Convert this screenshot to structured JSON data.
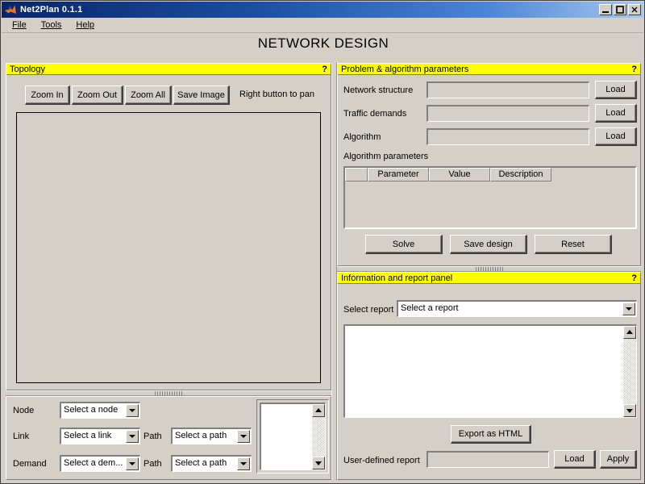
{
  "window": {
    "title": "Net2Plan 0.1.1",
    "icon": "matlab-icon",
    "controls": {
      "minimize": "_",
      "maximize": "□",
      "close": "✕"
    }
  },
  "menubar": {
    "items": [
      {
        "label": "File",
        "mnemonic": "F"
      },
      {
        "label": "Tools",
        "mnemonic": "T"
      },
      {
        "label": "Help",
        "mnemonic": "H"
      }
    ]
  },
  "heading": "NETWORK DESIGN",
  "topology_panel": {
    "title": "Topology",
    "help": "?",
    "buttons": [
      "Zoom In",
      "Zoom Out",
      "Zoom All",
      "Save Image"
    ],
    "hint": "Right button to pan",
    "canvas_content": ""
  },
  "selectors": {
    "node": {
      "label": "Node",
      "value": "Select a node"
    },
    "link": {
      "label": "Link",
      "value": "Select a link"
    },
    "link_path": {
      "label": "Path",
      "value": "Select a path"
    },
    "demand": {
      "label": "Demand",
      "value": "Select a dem..."
    },
    "demand_path": {
      "label": "Path",
      "value": "Select a path"
    },
    "detail_text": ""
  },
  "problem_panel": {
    "title": "Problem & algorithm parameters",
    "help": "?",
    "fields": [
      {
        "label": "Network structure",
        "value": "",
        "button": "Load"
      },
      {
        "label": "Traffic demands",
        "value": "",
        "button": "Load"
      },
      {
        "label": "Algorithm",
        "value": "",
        "button": "Load"
      }
    ],
    "table_label": "Algorithm parameters",
    "table": {
      "columns": [
        "",
        "Parameter",
        "Value",
        "Description"
      ],
      "rows": []
    },
    "actions": [
      "Solve",
      "Save design",
      "Reset"
    ]
  },
  "report_panel": {
    "title": "Information and report panel",
    "help": "?",
    "select_report_label": "Select report",
    "select_report_value": "Select a report",
    "report_content": "",
    "export_button": "Export as HTML",
    "user_report_label": "User-defined report",
    "user_report_value": "",
    "load_button": "Load",
    "apply_button": "Apply"
  },
  "colors": {
    "panel_title_bg": "#ffff00",
    "window_bg": "#d4d0c8",
    "titlebar_start": "#0a246a",
    "titlebar_end": "#a6c8ef"
  }
}
